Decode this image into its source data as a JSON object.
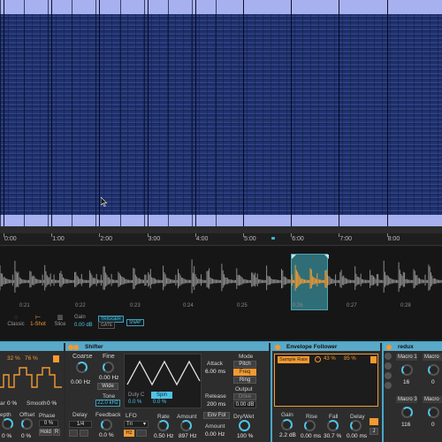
{
  "ruler": {
    "labels": [
      "0:00",
      "1:00",
      "2:00",
      "3:00",
      "4:00",
      "5:00",
      "6:00",
      "7:00",
      "8:00"
    ]
  },
  "sample": {
    "time_labels": [
      "0:21",
      "0:22",
      "0:23",
      "0:24",
      "0:25",
      "0:26",
      "0:27",
      "0:28"
    ],
    "modes": {
      "classic": "Classic",
      "oneshot": "1-Shot",
      "slice": "Slice"
    },
    "gain_label": "Gain",
    "gain_value": "0.00 dB",
    "trigger_label": "TRIGGER",
    "gate_label": "GATE",
    "snap_label": "SNAP"
  },
  "devices": {
    "left_fragment": {
      "value_a": "32 %",
      "value_b": "76 %",
      "depth_label": "epth",
      "offset_label": "Offset",
      "phase_label": "Phase",
      "phase_value": "0 %",
      "rate_label": "ar",
      "rate_value": "0 %",
      "smooth_label": "Smooth",
      "smooth_value": "0 %",
      "depth_value": "0 %",
      "offset_value": "0 %",
      "hold_label": "Hold",
      "r_label": "R"
    },
    "shifter": {
      "title": "Shifter",
      "coarse_label": "Coarse",
      "coarse_value": "0.00 Hz",
      "fine_label": "Fine",
      "fine_value": "0.00 Hz",
      "wide_label": "Wide",
      "tone_label": "Tone",
      "tone_value": "22.0 kHz",
      "duty_label": "Duty C",
      "duty_value": "0.0 %",
      "spin_label": "Spin",
      "spin_value": "0.0 %",
      "attack_label": "Attack",
      "attack_value": "6.00 ms",
      "release_label": "Release",
      "release_value": "200 ms",
      "mode_label": "Mode",
      "pitch_label": "Pitch",
      "freq_label": "Freq",
      "ring_label": "Ring",
      "output_label": "Output",
      "drive_label": "Drive",
      "output_value": "0.00 dB",
      "delay_label": "Delay",
      "delay_value": "1/4",
      "feedback_label": "Feedback",
      "feedback_value": "0.0 %",
      "lfo_label": "LFO",
      "lfo_wave": "Tri",
      "hz_label": "Hz",
      "rate_label": "Rate",
      "rate_value": "0.50 Hz",
      "amount_label": "Amount",
      "amount_value": "897 Hz",
      "envfol_label": "Env Fol",
      "env_amount_label": "Amount",
      "env_amount_value": "0.00 Hz",
      "drywet_label": "Dry/Wet",
      "drywet_value": "100 %"
    },
    "envelope_follower": {
      "title": "Envelope Follower",
      "sample_rate_label": "Sample Rate",
      "value_a": "43 %",
      "value_b": "85 %",
      "gain_label": "Gain",
      "gain_value": "2.2 dB",
      "rise_label": "Rise",
      "rise_value": "0.00 ms",
      "fall_label": "Fall",
      "fall_value": "30.7 %",
      "delay_label": "Delay",
      "delay_value": "0.00 ms",
      "j_label": "J"
    },
    "redux": {
      "title": "redux",
      "macro1_label": "Macro 1",
      "macro1_value": "16",
      "macro2_label": "Macro",
      "macro2_value": "0",
      "macro3_label": "Macro 3",
      "macro3_value": "116",
      "macro4_label": "Macro",
      "macro4_value": "0"
    }
  },
  "colors": {
    "accent_orange": "#f39a31",
    "accent_blue": "#4fc3e6",
    "roll_lavender": "#a7b1f0",
    "roll_navy": "#22336f",
    "region_teal": "#2f6d77"
  }
}
